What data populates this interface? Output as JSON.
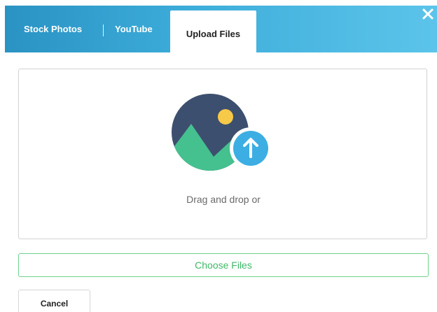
{
  "tabs": [
    {
      "label": "Stock Photos",
      "active": false
    },
    {
      "label": "YouTube",
      "active": false
    },
    {
      "label": "Upload Files",
      "active": true
    }
  ],
  "close_icon": "close-icon",
  "dropzone": {
    "icon": "image-upload-icon",
    "text": "Drag and drop or"
  },
  "choose_button": {
    "label": "Choose Files"
  },
  "cancel_button": {
    "label": "Cancel"
  },
  "colors": {
    "header_start": "#2a93c4",
    "header_end": "#5cc4ea",
    "choose_accent": "#3fb868",
    "upload_badge": "#3daee3",
    "image_bg": "#3d4f6e",
    "mountain": "#45c08f",
    "sun": "#f7c948"
  }
}
